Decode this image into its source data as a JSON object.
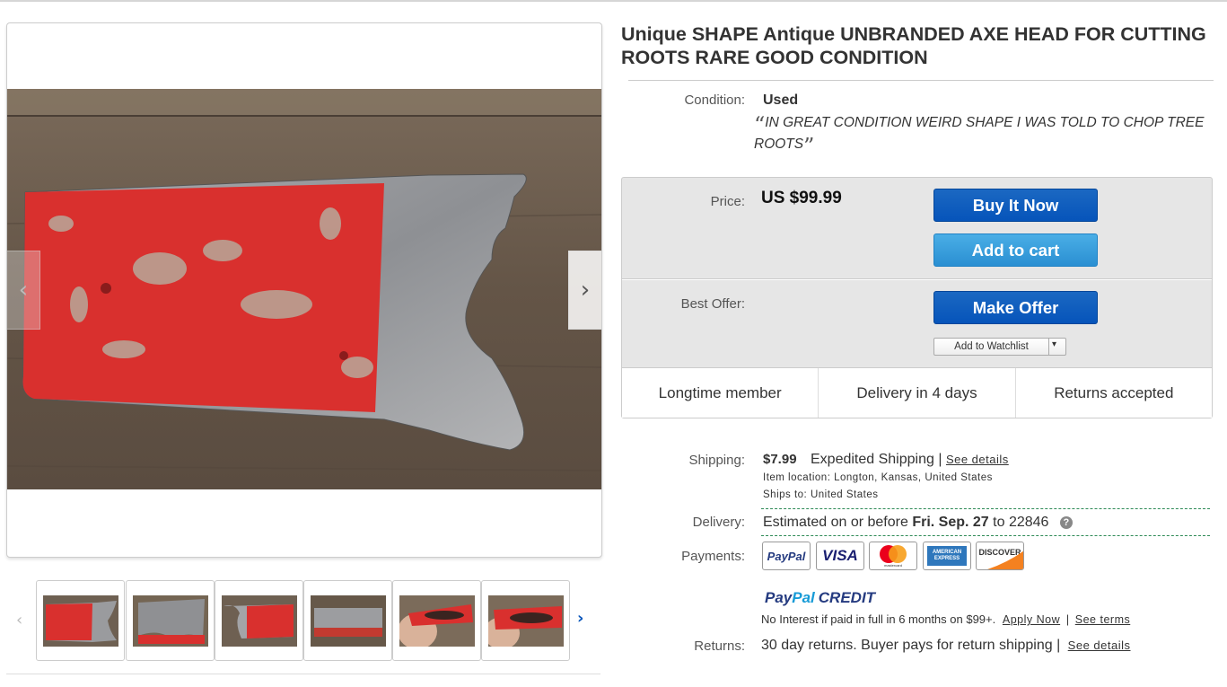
{
  "listing": {
    "title": "Unique SHAPE Antique UNBRANDED AXE HEAD FOR CUTTING ROOTS RARE GOOD CONDITION"
  },
  "condition": {
    "label": "Condition:",
    "value": "Used",
    "description": "IN GREAT CONDITION WEIRD SHAPE I WAS TOLD TO CHOP TREE ROOTS"
  },
  "price": {
    "label": "Price:",
    "value": "US $99.99",
    "buy_now": "Buy It Now",
    "add_to_cart": "Add to cart"
  },
  "offer": {
    "label": "Best Offer:",
    "make_offer": "Make Offer",
    "watchlist": "Add to Watchlist"
  },
  "features": [
    "Longtime member",
    "Delivery in 4 days",
    "Returns accepted"
  ],
  "shipping": {
    "label": "Shipping:",
    "price": "$7.99",
    "method": "Expedited Shipping |",
    "details_link": "See details",
    "location_label": "Item location:",
    "location": "Longton, Kansas, United States",
    "ships_to_label": "Ships to:",
    "ships_to": "United States"
  },
  "delivery": {
    "label": "Delivery:",
    "prefix": "Estimated on or before",
    "date": "Fri. Sep. 27",
    "to": "to 22846"
  },
  "payments": {
    "label": "Payments:",
    "methods": [
      "PayPal",
      "VISA",
      "mastercard",
      "AMERICAN EXPRESS",
      "DISCOVER"
    ]
  },
  "credit": {
    "logo_pay": "Pay",
    "logo_pal": "Pal",
    "logo_credit": "CREDIT",
    "text": "No Interest if paid in full in 6 months on $99+.",
    "apply_link": "Apply Now",
    "separator": "|",
    "terms_link": "See terms"
  },
  "returns": {
    "label": "Returns:",
    "text": "30 day returns. Buyer pays for return shipping |",
    "details_link": "See details"
  },
  "gallery": {
    "prev_icon": "chevron-left-icon",
    "next_icon": "chevron-right-icon",
    "thumb_count": 6
  },
  "colors": {
    "accent": "#0654ba",
    "paint_red": "#d9302e",
    "wood": "#6b5d4f"
  }
}
